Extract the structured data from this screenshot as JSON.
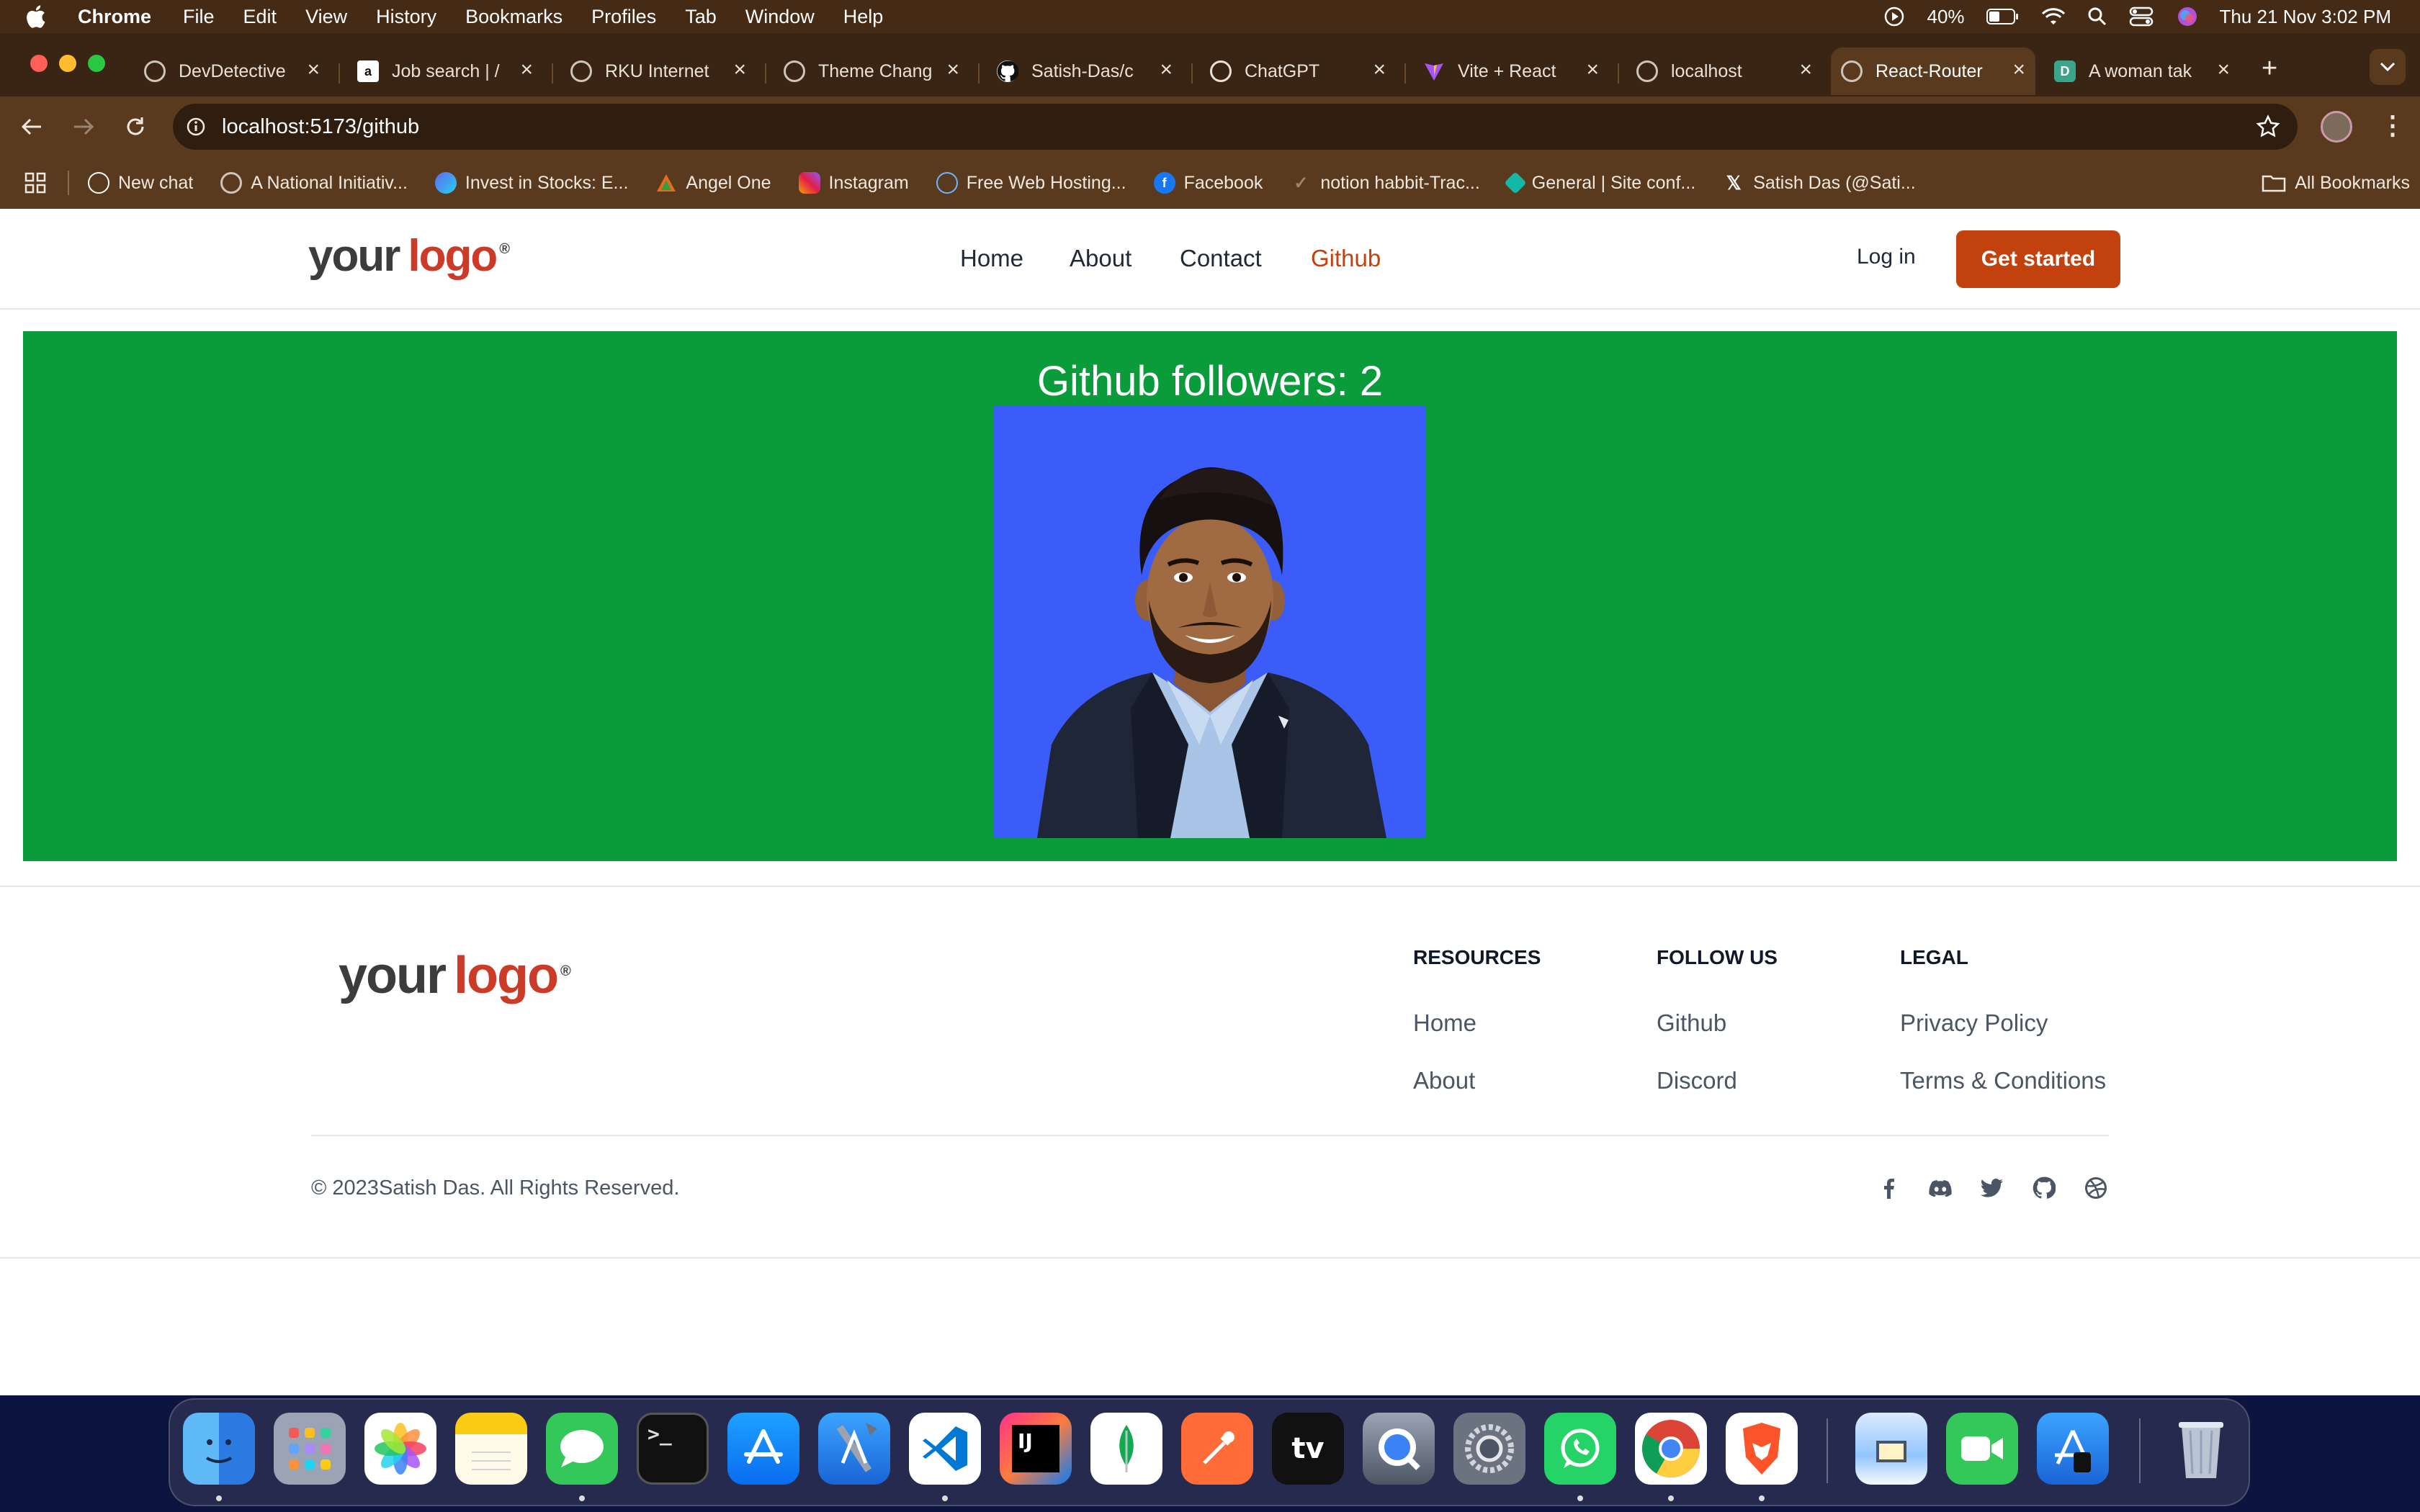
{
  "menubar": {
    "app": "Chrome",
    "items": [
      "File",
      "Edit",
      "View",
      "History",
      "Bookmarks",
      "Profiles",
      "Tab",
      "Window",
      "Help"
    ],
    "battery": "40%",
    "datetime": "Thu 21 Nov  3:02 PM"
  },
  "tabs": [
    {
      "label": "DevDetective"
    },
    {
      "label": "Job search | /"
    },
    {
      "label": "RKU Internet"
    },
    {
      "label": "Theme Chang"
    },
    {
      "label": "Satish-Das/c"
    },
    {
      "label": "ChatGPT"
    },
    {
      "label": "Vite + React"
    },
    {
      "label": "localhost"
    },
    {
      "label": "React-Router"
    },
    {
      "label": "A woman tak"
    }
  ],
  "address_bar": {
    "url": "localhost:5173/github"
  },
  "bookmarks": [
    {
      "label": "New chat"
    },
    {
      "label": "A National Initiativ..."
    },
    {
      "label": "Invest in Stocks: E..."
    },
    {
      "label": "Angel One"
    },
    {
      "label": "Instagram"
    },
    {
      "label": "Free Web Hosting..."
    },
    {
      "label": "Facebook"
    },
    {
      "label": "notion habbit-Trac..."
    },
    {
      "label": "General | Site conf..."
    },
    {
      "label": "Satish Das (@Sati..."
    }
  ],
  "all_bookmarks": "All Bookmarks",
  "site": {
    "logo": {
      "your": "your",
      "logo": "logo",
      "reg": "®"
    },
    "nav": [
      "Home",
      "About",
      "Contact",
      "Github"
    ],
    "active_nav": "Github",
    "login": "Log in",
    "get_started": "Get started",
    "colors": {
      "accent": "#c2410c",
      "section_bg": "#0a9b3b",
      "avatar_bg": "#3c5cfa"
    }
  },
  "github": {
    "followers_text": "Github followers: 2"
  },
  "footer": {
    "columns": [
      {
        "heading": "RESOURCES",
        "links": [
          "Home",
          "About"
        ]
      },
      {
        "heading": "FOLLOW US",
        "links": [
          "Github",
          "Discord"
        ]
      },
      {
        "heading": "LEGAL",
        "links": [
          "Privacy Policy",
          "Terms & Conditions"
        ]
      }
    ],
    "copyright": "© 2023Satish Das. All Rights Reserved.",
    "social_icons": [
      "facebook-icon",
      "discord-icon",
      "twitter-icon",
      "github-icon",
      "dribbble-icon"
    ]
  },
  "dock": {
    "apps": [
      "finder",
      "launchpad",
      "photos",
      "notes",
      "messages",
      "terminal",
      "app-store",
      "xcode",
      "vscode",
      "intellij",
      "mongodb-compass",
      "postman",
      "apple-tv",
      "quicktime",
      "system-settings",
      "whatsapp",
      "chrome",
      "brave",
      "preview",
      "facetime",
      "simulator",
      "trash"
    ],
    "labels": {
      "intellij": "IJ",
      "apple_tv": "tv"
    }
  }
}
